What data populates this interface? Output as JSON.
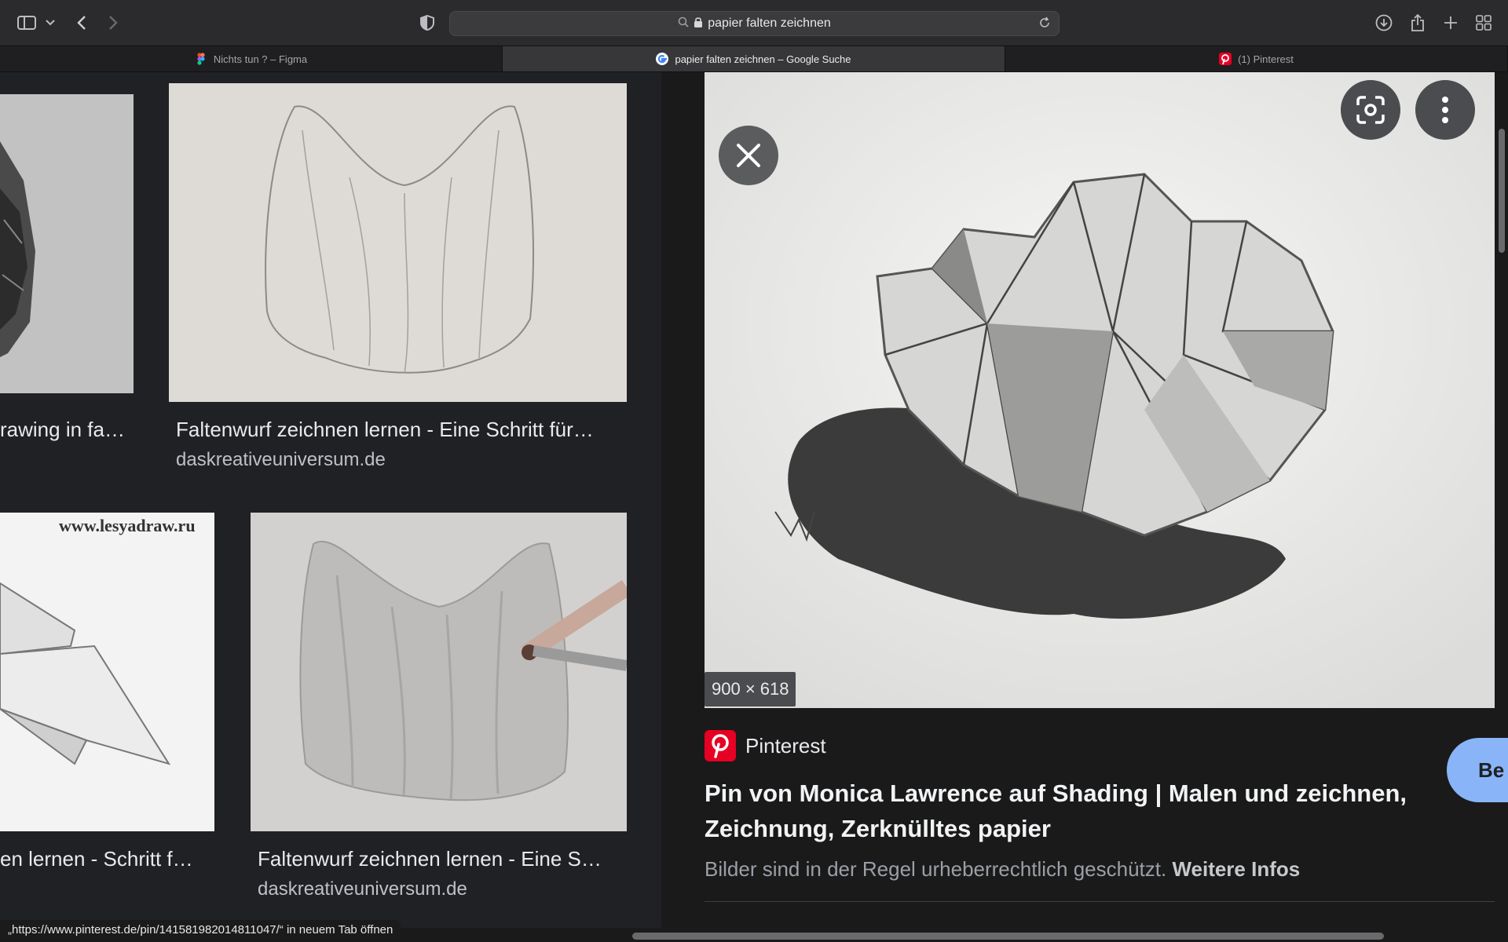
{
  "toolbar": {
    "url": "papier falten zeichnen"
  },
  "tabs": [
    {
      "label": "Nichts tun ? – Figma",
      "favicon_color": "#a259ff"
    },
    {
      "label": "papier falten zeichnen – Google Suche",
      "favicon_color": "#4285f4"
    },
    {
      "label": "(1) Pinterest",
      "favicon_color": "#e60023"
    }
  ],
  "results": [
    {
      "title": "rawing in fa…",
      "source": ""
    },
    {
      "title": "Faltenwurf zeichnen lernen - Eine Schritt für…",
      "source": "daskreativeuniversum.de"
    },
    {
      "title": "en lernen - Schritt f…",
      "source": "",
      "watermark": "www.lesyadraw.ru"
    },
    {
      "title": "Faltenwurf zeichnen lernen - Eine S…",
      "source": "daskreativeuniversum.de"
    }
  ],
  "panel": {
    "dimensions": "900 × 618",
    "source_name": "Pinterest",
    "title": "Pin von Monica Lawrence auf Shading | Malen und zeichnen, Zeichnung, Zerknülltes papier",
    "copyright": "Bilder sind in der Regel urheberrechtlich geschützt.",
    "more_info": "Weitere Infos",
    "visit_label": "Be"
  },
  "status": {
    "link_hint": "„https://www.pinterest.de/pin/141581982014811047/“ in neuem Tab öffnen"
  },
  "colors": {
    "accent": "#8ab4f8",
    "pinterest": "#e60023"
  }
}
